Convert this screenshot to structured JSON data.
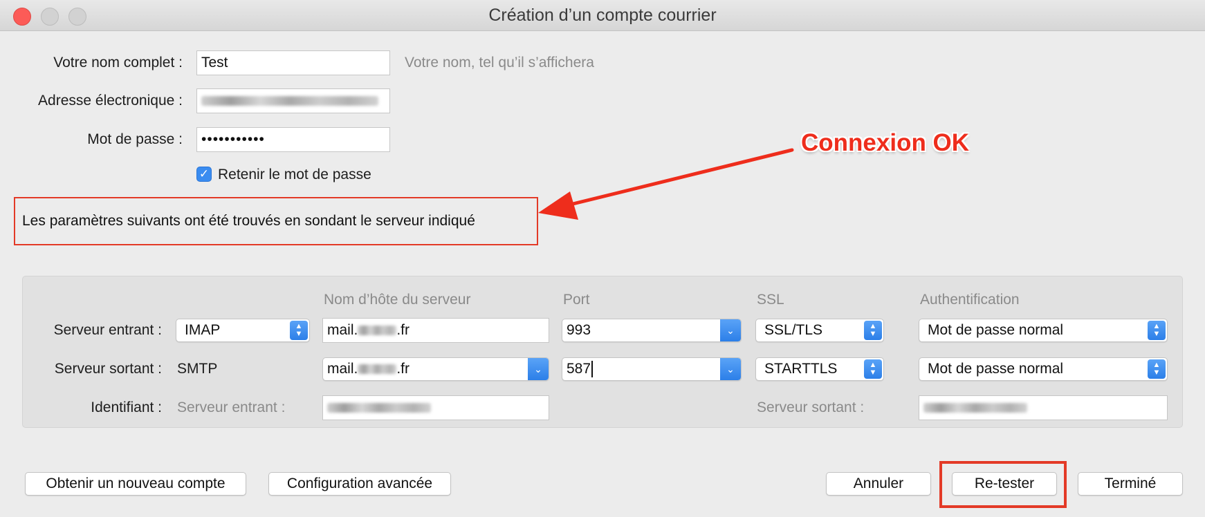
{
  "window": {
    "title": "Création d’un compte courrier"
  },
  "form": {
    "name_label": "Votre nom complet :",
    "name_value": "Test",
    "name_hint": "Votre nom, tel qu’il s’affichera",
    "email_label": "Adresse électronique :",
    "password_label": "Mot de passe :",
    "password_value": "•••••••••••",
    "remember_label": "Retenir le mot de passe",
    "remember_checked": true
  },
  "notice": {
    "text": "Les paramètres suivants ont été trouvés en sondant le serveur indiqué"
  },
  "annotation": {
    "text": "Connexion OK",
    "color": "#ee2d1c"
  },
  "server": {
    "headers": {
      "hostname": "Nom d’hôte du serveur",
      "port": "Port",
      "ssl": "SSL",
      "auth": "Authentification"
    },
    "incoming": {
      "label": "Serveur entrant :",
      "protocol": "IMAP",
      "host_prefix": "mail.",
      "host_suffix": ".fr",
      "port": "993",
      "ssl": "SSL/TLS",
      "auth": "Mot de passe normal"
    },
    "outgoing": {
      "label": "Serveur sortant :",
      "protocol": "SMTP",
      "host_prefix": "mail.",
      "host_suffix": ".fr",
      "port": "587",
      "ssl": "STARTTLS",
      "auth": "Mot de passe normal"
    },
    "identifier": {
      "label": "Identifiant :",
      "incoming_label": "Serveur entrant :",
      "outgoing_label": "Serveur sortant :"
    }
  },
  "buttons": {
    "new_account": "Obtenir un nouveau compte",
    "advanced": "Configuration avancée",
    "cancel": "Annuler",
    "retest": "Re-tester",
    "done": "Terminé"
  },
  "colors": {
    "accent": "#2c7fe8",
    "highlight": "#e33a27"
  }
}
